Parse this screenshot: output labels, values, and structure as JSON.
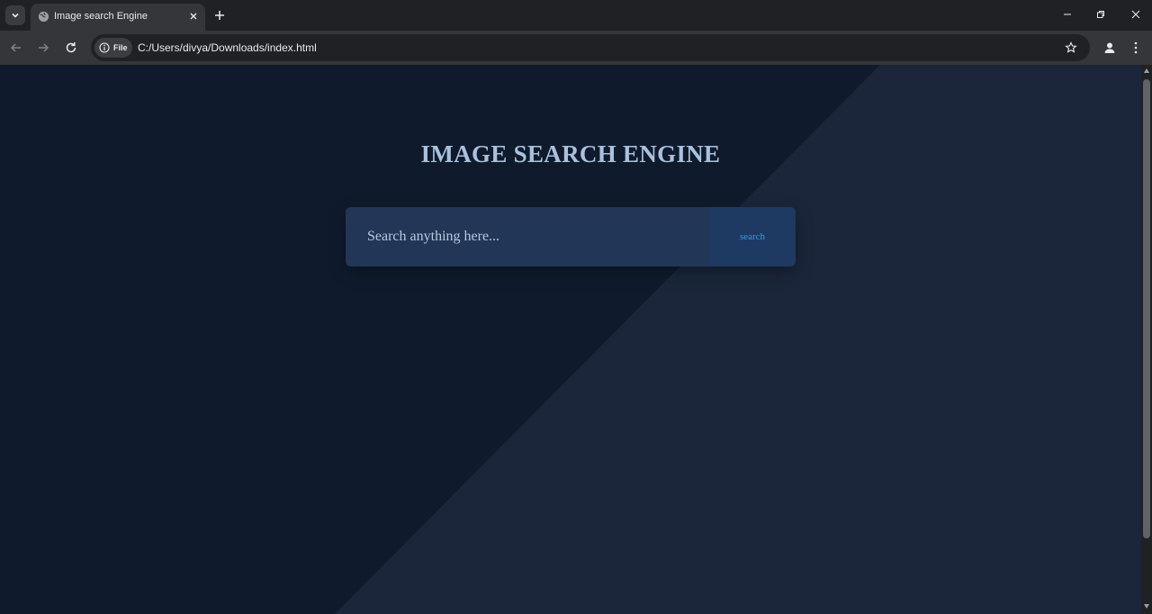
{
  "browser": {
    "tab": {
      "title": "Image search Engine",
      "favicon": "globe-icon"
    },
    "address": {
      "chip_label": "File",
      "url": "C:/Users/divya/Downloads/index.html"
    },
    "icons": {
      "tab_search": "chevron-down-icon",
      "close_tab": "close-icon",
      "new_tab": "plus-icon",
      "back": "arrow-left-icon",
      "forward": "arrow-right-icon",
      "reload": "reload-icon",
      "info": "info-icon",
      "bookmark": "star-icon",
      "profile": "person-icon",
      "menu": "kebab-icon",
      "minimize": "minimize-icon",
      "restore": "restore-icon",
      "close_window": "close-icon"
    }
  },
  "page": {
    "title": "IMAGE SEARCH ENGINE",
    "search": {
      "placeholder": "Search anything here...",
      "value": "",
      "button_label": "search"
    },
    "colors": {
      "bg_dark": "#0f1b2d",
      "bg_light": "#1b263b",
      "title": "#a9c1dc",
      "search_box": "#223658",
      "button_bg": "#1e3a62",
      "button_text": "#2e9cf0"
    }
  }
}
